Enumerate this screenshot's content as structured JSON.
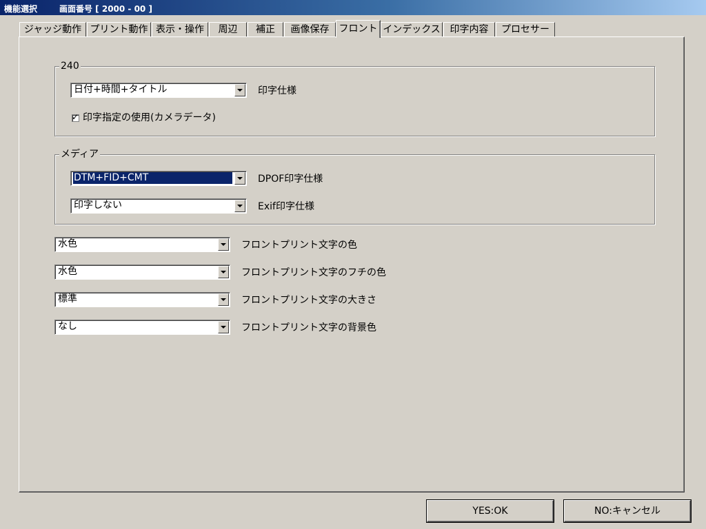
{
  "titlebar": {
    "app": "機能選択",
    "screen": "画面番号 [ 2000 - 00 ]"
  },
  "tabs": [
    {
      "label": "ジャッジ動作",
      "active": false
    },
    {
      "label": "プリント動作",
      "active": false
    },
    {
      "label": "表示・操作",
      "active": false
    },
    {
      "label": "周辺",
      "active": false
    },
    {
      "label": "補正",
      "active": false
    },
    {
      "label": "画像保存",
      "active": false
    },
    {
      "label": "フロント",
      "active": true
    },
    {
      "label": "インデックス",
      "active": false
    },
    {
      "label": "印字内容",
      "active": false
    },
    {
      "label": "プロセサー",
      "active": false
    }
  ],
  "group_240": {
    "title": "240",
    "print_spec": {
      "value": "日付+時間+タイトル",
      "label": "印字仕様"
    },
    "camera_data": {
      "checked": true,
      "mark": "✓",
      "label": "印字指定の使用(カメラデータ)"
    }
  },
  "group_media": {
    "title": "メディア",
    "dpof": {
      "value": "DTM+FID+CMT",
      "label": "DPOF印字仕様"
    },
    "exif": {
      "value": "印字しない",
      "label": "Exif印字仕様"
    }
  },
  "front_settings": [
    {
      "value": "水色",
      "label": "フロントプリント文字の色"
    },
    {
      "value": "水色",
      "label": "フロントプリント文字のフチの色"
    },
    {
      "value": "標準",
      "label": "フロントプリント文字の大きさ"
    },
    {
      "value": "なし",
      "label": "フロントプリント文字の背景色"
    }
  ],
  "buttons": {
    "ok": "YES:OK",
    "cancel": "NO:キャンセル"
  }
}
